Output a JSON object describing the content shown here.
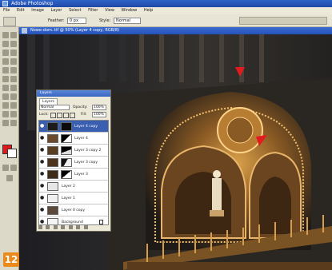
{
  "app": {
    "title": "Adobe Photoshop"
  },
  "menu": [
    "File",
    "Edit",
    "Image",
    "Layer",
    "Select",
    "Filter",
    "View",
    "Window",
    "Help"
  ],
  "options": {
    "feather_label": "Feather:",
    "feather_value": "0 px",
    "style_label": "Style:",
    "style_value": "Normal"
  },
  "document": {
    "title": "Nowe-dom..tif @ 50% (Layer 4 copy, RGB/8)"
  },
  "colors": {
    "foreground": "#e0191c",
    "background": "#ffffff",
    "accent": "#e98a1a"
  },
  "layers_panel": {
    "title": "Layers",
    "tab": "Layers",
    "blend_mode": "Normal",
    "opacity_label": "Opacity:",
    "opacity_value": "100%",
    "lock_label": "Lock:",
    "fill_label": "Fill:",
    "fill_value": "100%",
    "layers": [
      {
        "name": "Layer 4 copy",
        "selected": true,
        "has_mask": true
      },
      {
        "name": "Layer 4",
        "selected": false,
        "has_mask": true
      },
      {
        "name": "Layer 3 copy 2",
        "selected": false,
        "has_mask": true
      },
      {
        "name": "Layer 3 copy",
        "selected": false,
        "has_mask": true
      },
      {
        "name": "Layer 3",
        "selected": false,
        "has_mask": true
      },
      {
        "name": "Layer 2",
        "selected": false,
        "has_mask": false
      },
      {
        "name": "Layer 1",
        "selected": false,
        "has_mask": false
      },
      {
        "name": "Layer 0 copy",
        "selected": false,
        "has_mask": false
      },
      {
        "name": "Background",
        "selected": false,
        "has_mask": false,
        "locked": true
      }
    ]
  },
  "step": "12"
}
